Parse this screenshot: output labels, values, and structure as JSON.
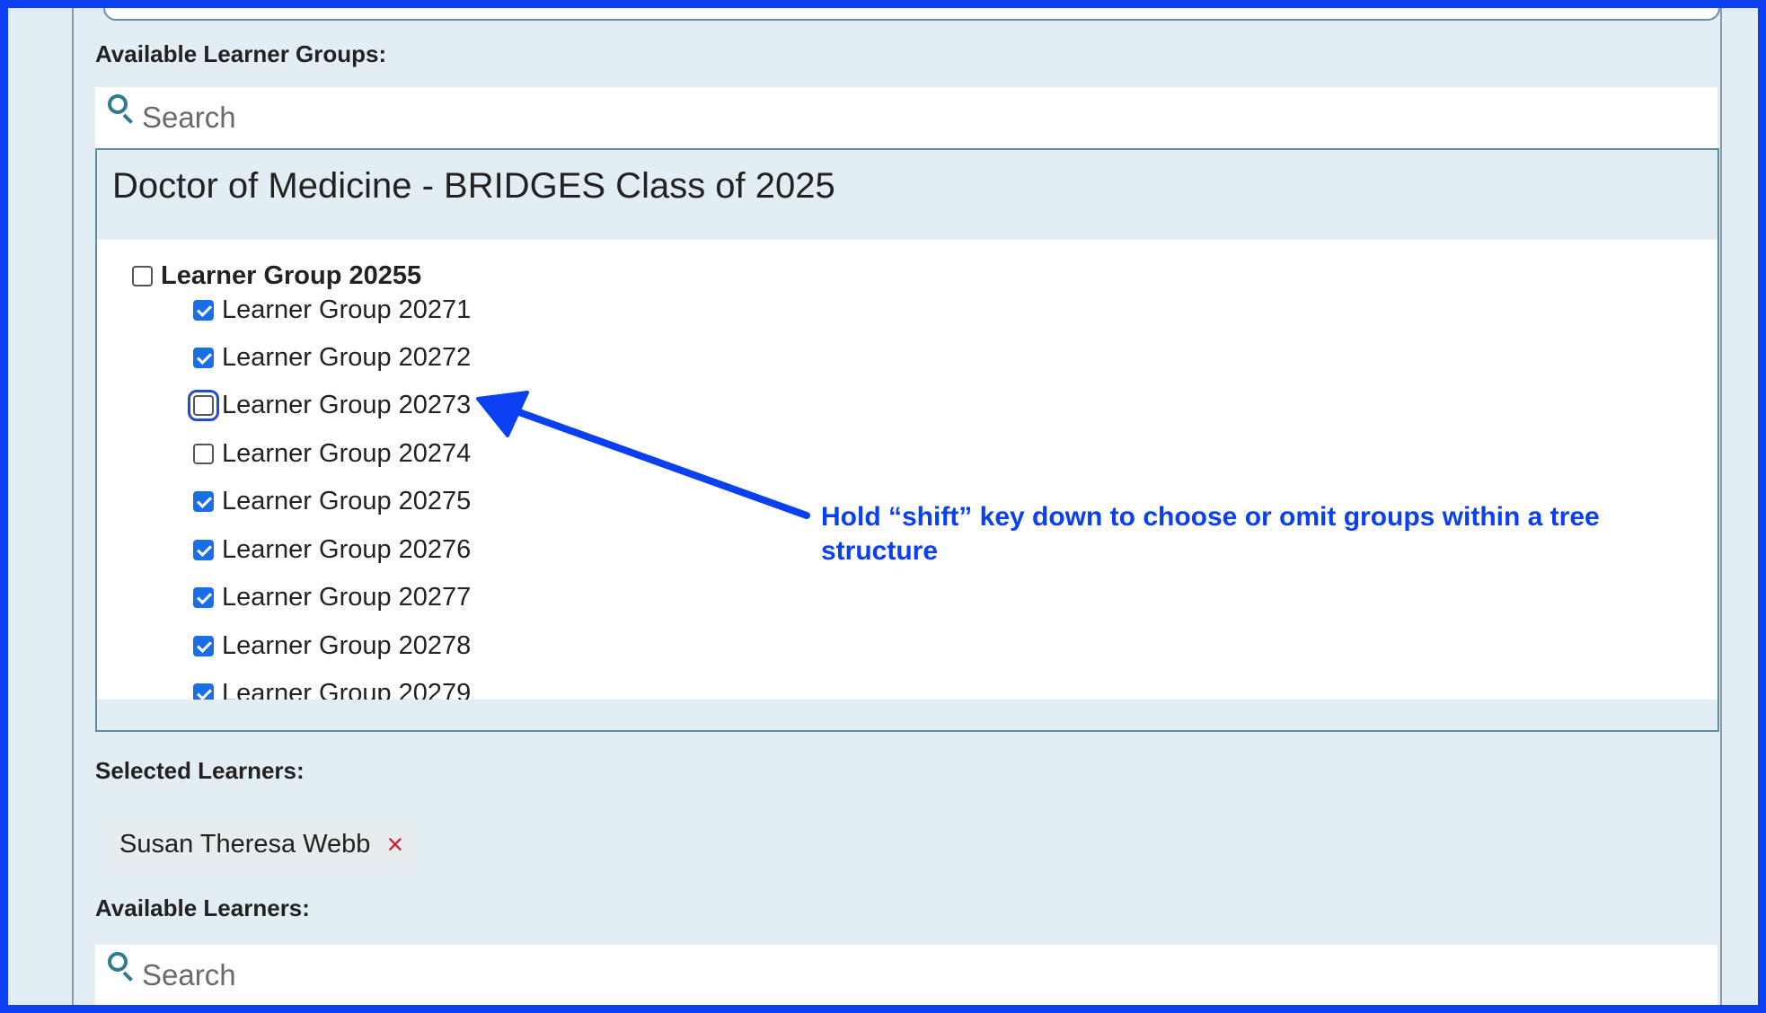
{
  "labels": {
    "available_groups": "Available Learner Groups:",
    "selected_learners": "Selected Learners:",
    "available_learners": "Available Learners:"
  },
  "group_search": {
    "placeholder": "Search",
    "value": ""
  },
  "learner_search": {
    "placeholder": "Search",
    "value": ""
  },
  "tree": {
    "title": "Doctor of Medicine - BRIDGES Class of 2025",
    "parent": {
      "label": "Learner Group 20255",
      "checked": false
    },
    "children": [
      {
        "label": "Learner Group 20271",
        "checked": true
      },
      {
        "label": "Learner Group 20272",
        "checked": true
      },
      {
        "label": "Learner Group 20273",
        "checked": false,
        "focused": true
      },
      {
        "label": "Learner Group 20274",
        "checked": false
      },
      {
        "label": "Learner Group 20275",
        "checked": true
      },
      {
        "label": "Learner Group 20276",
        "checked": true
      },
      {
        "label": "Learner Group 20277",
        "checked": true
      },
      {
        "label": "Learner Group 20278",
        "checked": true
      },
      {
        "label": "Learner Group 20279",
        "checked": true
      }
    ]
  },
  "selected_learners": [
    {
      "name": "Susan Theresa Webb",
      "remove_icon": "×"
    }
  ],
  "annotation": {
    "text": "Hold “shift” key down to choose or omit groups within a tree structure"
  },
  "colors": {
    "accent_blue": "#0a3ff2",
    "checkbox_blue": "#1a6ee8",
    "remove_red": "#d31b33",
    "panel_bg": "#e3edf4"
  }
}
